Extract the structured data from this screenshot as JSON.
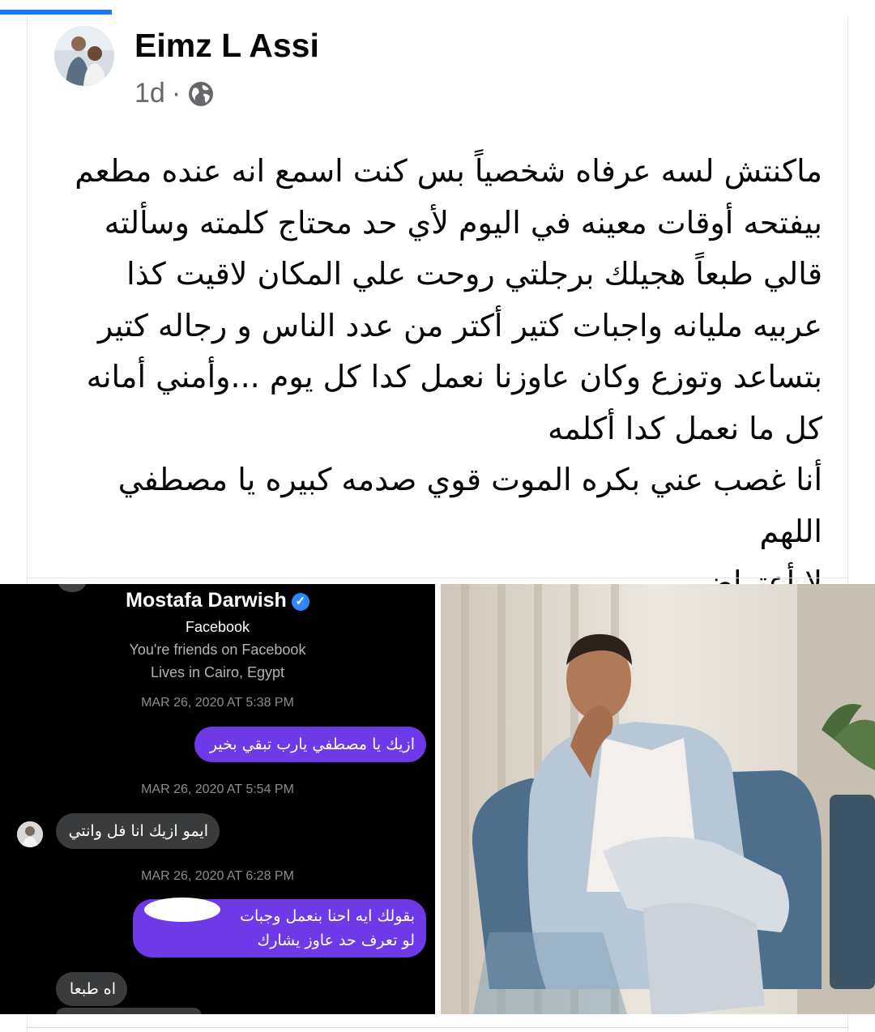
{
  "post": {
    "author": "Eimz L Assi",
    "time": "1d",
    "separator": "·",
    "privacy_icon": "globe-icon",
    "lines": [
      "ماكنتش لسه عرفاه شخصياً بس كنت اسمع انه عنده مطعم",
      "بيفتحه أوقات معينه في اليوم لأي حد محتاج كلمته وسألته",
      "قالي طبعاً هجيلك برجلتي روحت علي المكان لاقيت كذا",
      "عربيه مليانه واجبات كتير أكتر من عدد الناس و رجاله كتير",
      "بتساعد وتوزع وكان عاوزنا نعمل كدا كل يوم ...وأمني أمانه",
      "كل ما نعمل كدا أكلمه",
      "أنا غصب عني بكره الموت قوي صدمه كبيره يا مصطفي اللهم",
      "لا أعتراض"
    ]
  },
  "screenshot": {
    "profile_name": "Mostafa Darwish",
    "platform": "Facebook",
    "friends_text": "You're friends on Facebook",
    "lives_text": "Lives in Cairo, Egypt",
    "messages": [
      {
        "timestamp": "MAR 26, 2020 AT 5:38 PM",
        "text": "ازيك يا مصطفي يارب تبقي بخير",
        "dir": "out"
      },
      {
        "timestamp": "MAR 26, 2020 AT 5:54 PM",
        "text": "ايمو ازيك انا فل وانتي",
        "dir": "in"
      },
      {
        "timestamp": "MAR 26, 2020 AT 6:28 PM",
        "text_line1": "بقولك ايه احنا بنعمل وجبات",
        "text_line2": "لو تعرف حد عاوز يشارك",
        "dir": "out"
      },
      {
        "text": "اه طبعا",
        "dir": "in"
      }
    ]
  },
  "colors": {
    "accent": "#1877f2",
    "messenger_purple": "#6e3ae8",
    "incoming_bubble": "#3a3b3c"
  }
}
